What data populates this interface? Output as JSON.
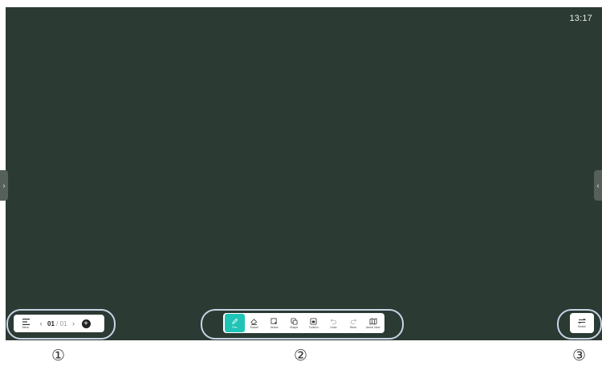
{
  "status": {
    "time": "13:17"
  },
  "page_nav": {
    "menu_label": "Menu",
    "current_page": "01",
    "separator": "/",
    "total_pages": "01"
  },
  "toolbar": {
    "tools": [
      {
        "label": "Pen",
        "icon": "pen-icon",
        "active": true
      },
      {
        "label": "Eraser",
        "icon": "eraser-icon"
      },
      {
        "label": "Select",
        "icon": "select-icon"
      },
      {
        "label": "Shape",
        "icon": "shape-icon"
      },
      {
        "label": "Toolbox",
        "icon": "toolbox-icon"
      },
      {
        "label": "Undo",
        "icon": "undo-icon"
      },
      {
        "label": "Redo",
        "icon": "redo-icon"
      },
      {
        "label": "Aerial View",
        "icon": "aerial-view-icon"
      }
    ]
  },
  "switch": {
    "label": "Switch"
  },
  "annotations": [
    "①",
    "②",
    "③"
  ],
  "colors": {
    "board": "#2b3a33",
    "accent": "#1fc4b7",
    "ring": "#c8d4e6"
  }
}
